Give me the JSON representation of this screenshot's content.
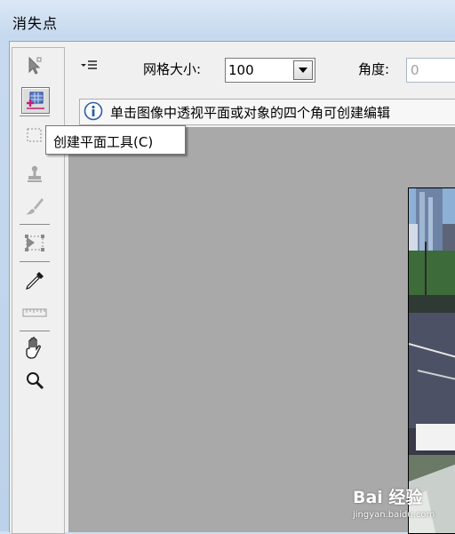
{
  "window": {
    "title": "消失点"
  },
  "options": {
    "grid_size_label": "网格大小:",
    "grid_size_value": "100",
    "angle_label": "角度:",
    "angle_value": "0"
  },
  "info": {
    "text": "单击图像中透视平面或对象的四个角可创建编辑"
  },
  "tooltip": {
    "text": "创建平面工具(C)"
  },
  "tools": [
    {
      "name": "edit-plane-tool",
      "icon": "arrow-icon"
    },
    {
      "name": "create-plane-tool",
      "icon": "create-plane-icon",
      "selected": true
    },
    {
      "name": "marquee-tool",
      "icon": "marquee-icon"
    },
    {
      "name": "stamp-tool",
      "icon": "stamp-icon"
    },
    {
      "name": "brush-tool",
      "icon": "brush-icon"
    },
    {
      "name": "transform-tool",
      "icon": "transform-icon"
    },
    {
      "name": "eyedropper-tool",
      "icon": "eyedropper-icon"
    },
    {
      "name": "measure-tool",
      "icon": "ruler-icon"
    },
    {
      "name": "hand-tool",
      "icon": "hand-icon"
    },
    {
      "name": "zoom-tool",
      "icon": "magnifier-icon"
    }
  ],
  "watermark": {
    "brand": "Bai 经验",
    "url": "jingyan.baidu.com"
  }
}
